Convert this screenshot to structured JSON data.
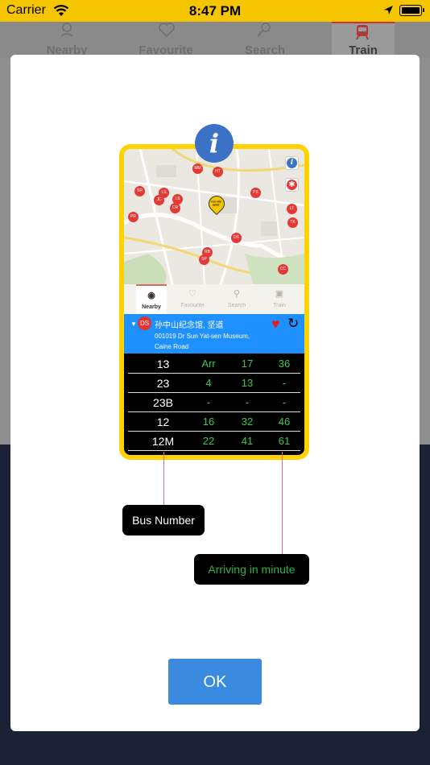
{
  "status_bar": {
    "carrier": "Carrier",
    "time": "8:47 PM"
  },
  "background_tabs": [
    {
      "label": "Nearby",
      "icon": "location-pin-icon"
    },
    {
      "label": "Favourite",
      "icon": "heart-icon"
    },
    {
      "label": "Search",
      "icon": "search-icon"
    },
    {
      "label": "Train",
      "icon": "train-icon",
      "active": true
    }
  ],
  "modal": {
    "info_icon": "i",
    "preview": {
      "map_markers": [
        "MM",
        "HT",
        "SR",
        "LS",
        "JC",
        "LS",
        "CR",
        "PR",
        "PS",
        "LT",
        "TK",
        "DS",
        "RB",
        "SP",
        "CC"
      ],
      "map_marker_highlight": "YOU ARE HERE",
      "tabs": [
        {
          "label": "Nearby",
          "active": true
        },
        {
          "label": "Favourite"
        },
        {
          "label": "Search"
        },
        {
          "label": "Train"
        }
      ],
      "stop": {
        "code": "DS",
        "name": "孙中山纪念馆, 坚道",
        "address_line1": "001019 Dr Sun Yat-sen Museum,",
        "address_line2": "Caine Road"
      },
      "eta_rows": [
        {
          "bus": "13",
          "eta": [
            "Arr",
            "17",
            "36"
          ]
        },
        {
          "bus": "23",
          "eta": [
            "4",
            "13",
            "-"
          ]
        },
        {
          "bus": "23B",
          "eta": [
            "-",
            "-",
            "-"
          ]
        },
        {
          "bus": "12",
          "eta": [
            "16",
            "32",
            "46"
          ]
        },
        {
          "bus": "12M",
          "eta": [
            "22",
            "41",
            "61"
          ]
        }
      ]
    },
    "callout_bus_number": "Bus Number",
    "callout_arriving": "Arriving in minute",
    "ok_label": "OK"
  },
  "colors": {
    "status_bar": "#f5c600",
    "modal_frame": "#ffd200",
    "stop_header": "#1e90ff",
    "eta_text": "#3bc94b",
    "ok_button": "#3a8ae0",
    "info_badge": "#3c72c5"
  }
}
